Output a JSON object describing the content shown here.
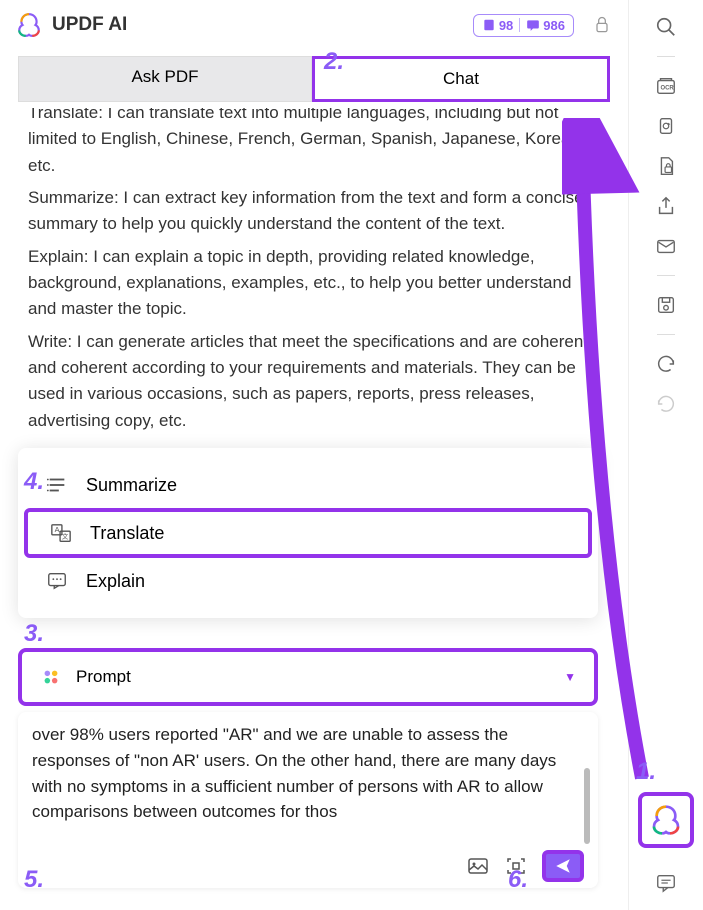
{
  "header": {
    "title": "UPDF AI",
    "badge1": "98",
    "badge2": "986"
  },
  "tabs": {
    "ask": "Ask PDF",
    "chat": "Chat"
  },
  "content": {
    "p1": "Translate: I can translate text into multiple languages, including but not limited to English, Chinese, French, German, Spanish, Japanese, Korean, etc.",
    "p2": "Summarize: I can extract key information from the text and form a concise summary to help you quickly understand the content of the text.",
    "p3": "Explain: I can explain a topic in depth, providing related knowledge, background, explanations, examples, etc., to help you better understand and master the topic.",
    "p4": "Write: I can generate articles that meet the specifications and are coherent and coherent according to your requirements and materials. They can be used in various occasions, such as papers, reports, press releases, advertising copy, etc."
  },
  "menu": {
    "summarize": "Summarize",
    "translate": "Translate",
    "explain": "Explain"
  },
  "prompt": {
    "label": "Prompt"
  },
  "input": {
    "text": "over 98% users reported \"AR\" and we are unable to assess the responses of \"non AR' users. On the other hand, there are many days with no symptoms in a sufficient number of persons with AR to allow comparisons between outcomes for thos"
  },
  "annotations": {
    "n1": "1.",
    "n2": "2.",
    "n3": "3.",
    "n4": "4.",
    "n5": "5.",
    "n6": "6."
  }
}
